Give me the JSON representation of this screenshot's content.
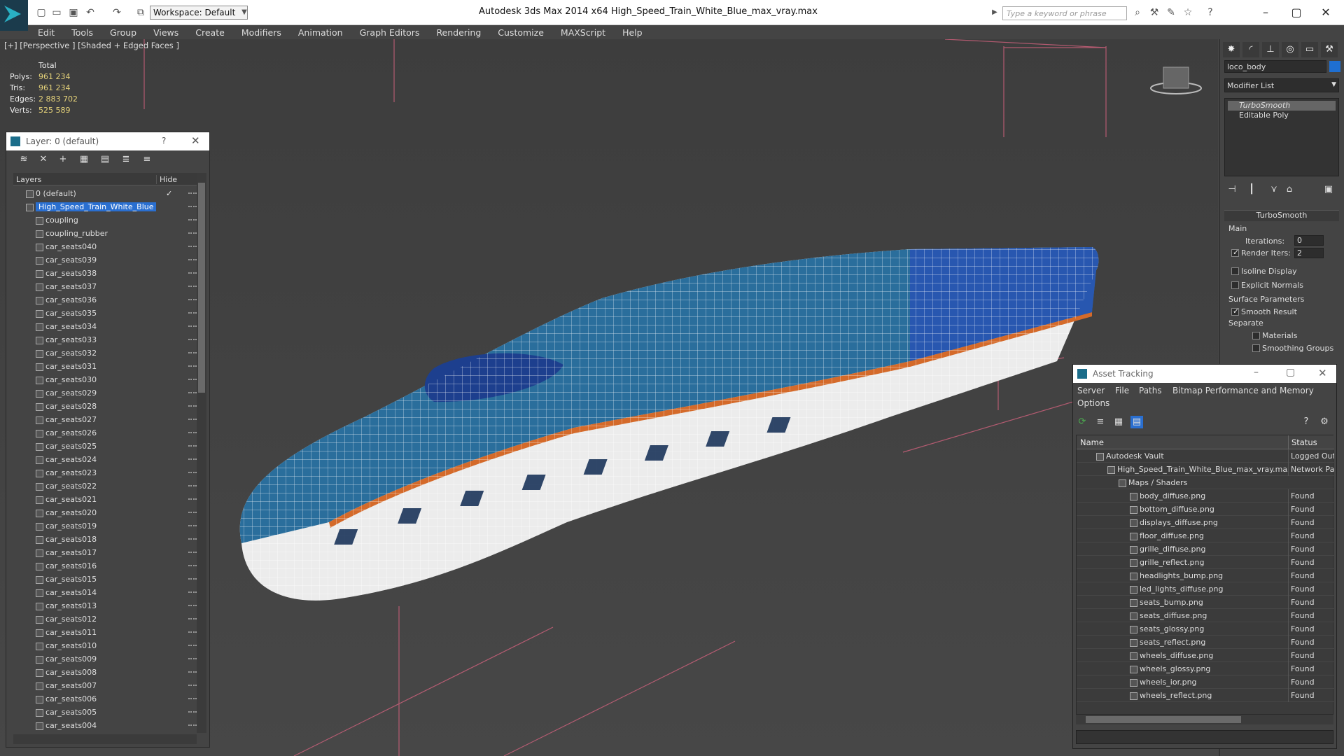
{
  "titlebar": {
    "workspace": "Workspace: Default",
    "app_title": "Autodesk 3ds Max  2014 x64     High_Speed_Train_White_Blue_max_vray.max",
    "search_placeholder": "Type a keyword or phrase"
  },
  "menu": [
    "Edit",
    "Tools",
    "Group",
    "Views",
    "Create",
    "Modifiers",
    "Animation",
    "Graph Editors",
    "Rendering",
    "Customize",
    "MAXScript",
    "Help"
  ],
  "viewport": {
    "label": "[+] [Perspective ] [Shaded + Edged Faces ]",
    "stats": {
      "total_label": "Total",
      "rows": [
        {
          "label": "Polys:",
          "value": "961 234"
        },
        {
          "label": "Tris:",
          "value": "961 234"
        },
        {
          "label": "Edges:",
          "value": "2 883 702"
        },
        {
          "label": "Verts:",
          "value": "525 589"
        }
      ]
    }
  },
  "layers": {
    "title": "Layer: 0 (default)",
    "help": "?",
    "col_layers": "Layers",
    "col_hide": "Hide",
    "rows": [
      {
        "name": "0 (default)",
        "indent": 1,
        "check": true
      },
      {
        "name": "High_Speed_Train_White_Blue",
        "indent": 1,
        "selected": true
      },
      {
        "name": "coupling",
        "indent": 2
      },
      {
        "name": "coupling_rubber",
        "indent": 2
      },
      {
        "name": "car_seats040",
        "indent": 2
      },
      {
        "name": "car_seats039",
        "indent": 2
      },
      {
        "name": "car_seats038",
        "indent": 2
      },
      {
        "name": "car_seats037",
        "indent": 2
      },
      {
        "name": "car_seats036",
        "indent": 2
      },
      {
        "name": "car_seats035",
        "indent": 2
      },
      {
        "name": "car_seats034",
        "indent": 2
      },
      {
        "name": "car_seats033",
        "indent": 2
      },
      {
        "name": "car_seats032",
        "indent": 2
      },
      {
        "name": "car_seats031",
        "indent": 2
      },
      {
        "name": "car_seats030",
        "indent": 2
      },
      {
        "name": "car_seats029",
        "indent": 2
      },
      {
        "name": "car_seats028",
        "indent": 2
      },
      {
        "name": "car_seats027",
        "indent": 2
      },
      {
        "name": "car_seats026",
        "indent": 2
      },
      {
        "name": "car_seats025",
        "indent": 2
      },
      {
        "name": "car_seats024",
        "indent": 2
      },
      {
        "name": "car_seats023",
        "indent": 2
      },
      {
        "name": "car_seats022",
        "indent": 2
      },
      {
        "name": "car_seats021",
        "indent": 2
      },
      {
        "name": "car_seats020",
        "indent": 2
      },
      {
        "name": "car_seats019",
        "indent": 2
      },
      {
        "name": "car_seats018",
        "indent": 2
      },
      {
        "name": "car_seats017",
        "indent": 2
      },
      {
        "name": "car_seats016",
        "indent": 2
      },
      {
        "name": "car_seats015",
        "indent": 2
      },
      {
        "name": "car_seats014",
        "indent": 2
      },
      {
        "name": "car_seats013",
        "indent": 2
      },
      {
        "name": "car_seats012",
        "indent": 2
      },
      {
        "name": "car_seats011",
        "indent": 2
      },
      {
        "name": "car_seats010",
        "indent": 2
      },
      {
        "name": "car_seats009",
        "indent": 2
      },
      {
        "name": "car_seats008",
        "indent": 2
      },
      {
        "name": "car_seats007",
        "indent": 2
      },
      {
        "name": "car_seats006",
        "indent": 2
      },
      {
        "name": "car_seats005",
        "indent": 2
      },
      {
        "name": "car_seats004",
        "indent": 2
      }
    ]
  },
  "command_panel": {
    "object_name": "loco_body",
    "object_color": "#1f6fd1",
    "modifier_list": "Modifier List",
    "stack": [
      "TurboSmooth",
      "Editable Poly"
    ],
    "rollout_title": "TurboSmooth",
    "main_label": "Main",
    "iterations_label": "Iterations:",
    "iterations_value": "0",
    "render_iters_label": "Render Iters:",
    "render_iters_value": "2",
    "isoline": "Isoline Display",
    "explicit_normals": "Explicit Normals",
    "surface_params": "Surface Parameters",
    "smooth_result": "Smooth Result",
    "separate": "Separate",
    "materials": "Materials",
    "smoothing_groups": "Smoothing Groups"
  },
  "asset_tracking": {
    "title": "Asset Tracking",
    "menu": [
      "Server",
      "File",
      "Paths",
      "Bitmap Performance and Memory"
    ],
    "menu2": "Options",
    "col_name": "Name",
    "col_status": "Status",
    "rows": [
      {
        "name": "Autodesk Vault",
        "status": "Logged Out",
        "indent": 1
      },
      {
        "name": "High_Speed_Train_White_Blue_max_vray.max",
        "status": "Network Path",
        "indent": 2
      },
      {
        "name": "Maps / Shaders",
        "status": "",
        "indent": 3
      },
      {
        "name": "body_diffuse.png",
        "status": "Found",
        "indent": 4
      },
      {
        "name": "bottom_diffuse.png",
        "status": "Found",
        "indent": 4
      },
      {
        "name": "displays_diffuse.png",
        "status": "Found",
        "indent": 4
      },
      {
        "name": "floor_diffuse.png",
        "status": "Found",
        "indent": 4
      },
      {
        "name": "grille_diffuse.png",
        "status": "Found",
        "indent": 4
      },
      {
        "name": "grille_reflect.png",
        "status": "Found",
        "indent": 4
      },
      {
        "name": "headlights_bump.png",
        "status": "Found",
        "indent": 4
      },
      {
        "name": "led_lights_diffuse.png",
        "status": "Found",
        "indent": 4
      },
      {
        "name": "seats_bump.png",
        "status": "Found",
        "indent": 4
      },
      {
        "name": "seats_diffuse.png",
        "status": "Found",
        "indent": 4
      },
      {
        "name": "seats_glossy.png",
        "status": "Found",
        "indent": 4
      },
      {
        "name": "seats_reflect.png",
        "status": "Found",
        "indent": 4
      },
      {
        "name": "wheels_diffuse.png",
        "status": "Found",
        "indent": 4
      },
      {
        "name": "wheels_glossy.png",
        "status": "Found",
        "indent": 4
      },
      {
        "name": "wheels_ior.png",
        "status": "Found",
        "indent": 4
      },
      {
        "name": "wheels_reflect.png",
        "status": "Found",
        "indent": 4
      }
    ]
  }
}
